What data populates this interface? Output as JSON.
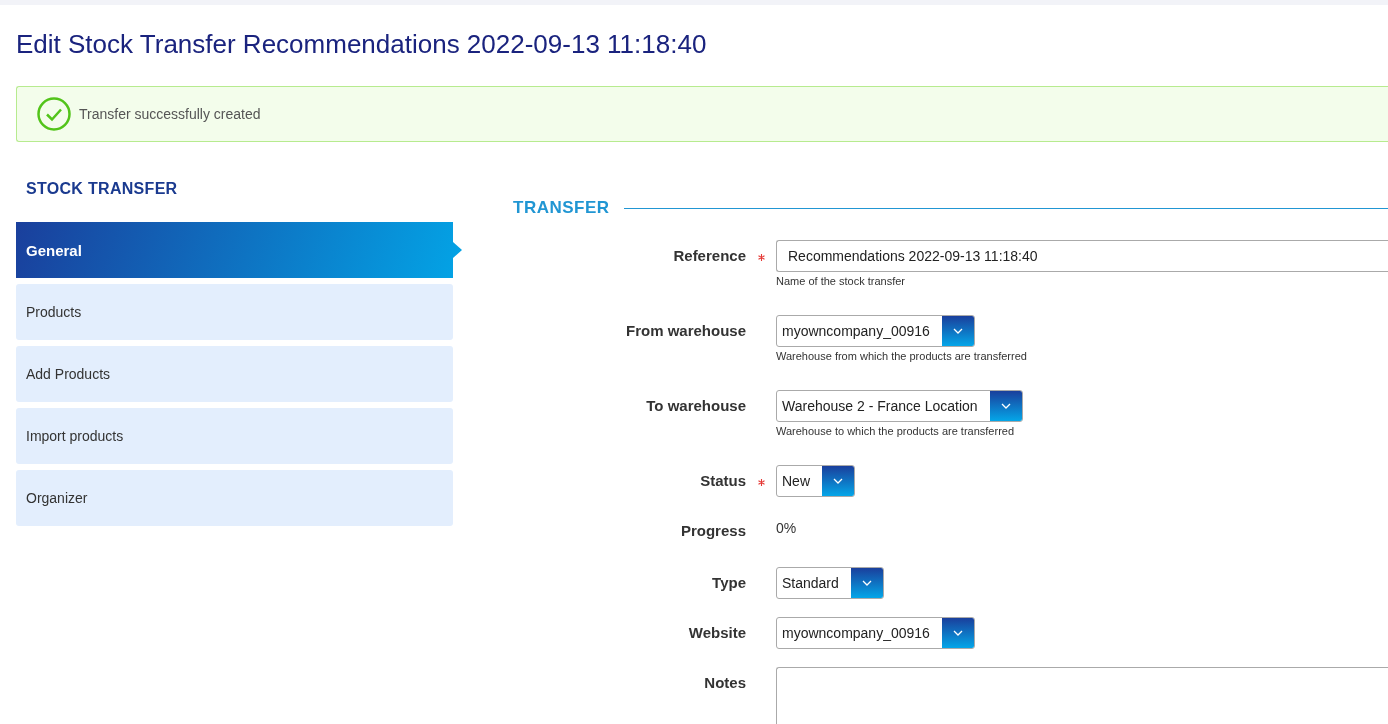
{
  "page": {
    "title": "Edit Stock Transfer Recommendations 2022-09-13 11:18:40"
  },
  "alert": {
    "message": "Transfer successfully created"
  },
  "sidebar": {
    "heading": "STOCK TRANSFER",
    "items": [
      {
        "label": "General",
        "selected": true
      },
      {
        "label": "Products",
        "selected": false
      },
      {
        "label": "Add Products",
        "selected": false
      },
      {
        "label": "Import products",
        "selected": false
      },
      {
        "label": "Organizer",
        "selected": false
      }
    ]
  },
  "form": {
    "section": "TRANSFER",
    "fields": [
      {
        "kind": "text",
        "label": "Reference",
        "required": true,
        "value": "Recommendations 2022-09-13 11:18:40",
        "help": "Name of the stock transfer"
      },
      {
        "kind": "select",
        "label": "From warehouse",
        "required": false,
        "value": "myowncompany_00916",
        "help": "Warehouse from which the products are transferred"
      },
      {
        "kind": "select",
        "label": "To warehouse",
        "required": false,
        "value": "Warehouse 2 - France Location",
        "help": "Warehouse to which the products are transferred"
      },
      {
        "kind": "select",
        "label": "Status",
        "required": true,
        "value": "New"
      },
      {
        "kind": "readonly",
        "label": "Progress",
        "required": false,
        "value": "0%"
      },
      {
        "kind": "select",
        "label": "Type",
        "required": false,
        "value": "Standard"
      },
      {
        "kind": "select",
        "label": "Website",
        "required": false,
        "value": "myowncompany_00916"
      },
      {
        "kind": "textarea",
        "label": "Notes",
        "required": false
      }
    ]
  }
}
